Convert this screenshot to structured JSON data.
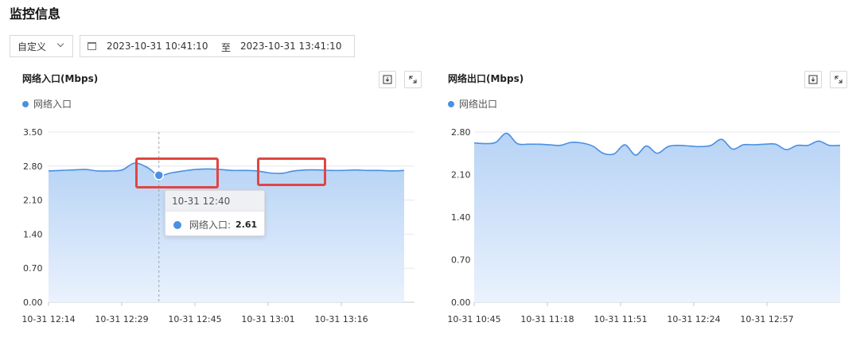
{
  "page": {
    "title": "监控信息"
  },
  "filter": {
    "range_select": "自定义",
    "start_time": "2023-10-31 10:41:10",
    "separator": "至",
    "end_time": "2023-10-31 13:41:10"
  },
  "panels": [
    {
      "title": "网络入口(Mbps)",
      "legend": "网络入口"
    },
    {
      "title": "网络出口(Mbps)",
      "legend": "网络出口"
    }
  ],
  "tooltip": {
    "time": "10-31 12:40",
    "series": "网络入口:",
    "value": "2.61"
  },
  "icons": {
    "download": "download-icon",
    "expand": "expand-icon",
    "calendar": "calendar-icon",
    "dropdown": "chevron-down-icon"
  },
  "colors": {
    "line": "#4a90e2",
    "area_top": "#b7d3f5",
    "area_bottom": "#eaf2fd",
    "highlight": "#e04545"
  },
  "chart_data": [
    {
      "type": "area",
      "title": "网络入口(Mbps)",
      "series": [
        {
          "name": "网络入口",
          "values": [
            2.7,
            2.71,
            2.72,
            2.73,
            2.7,
            2.7,
            2.72,
            2.86,
            2.78,
            2.61,
            2.66,
            2.7,
            2.73,
            2.74,
            2.73,
            2.71,
            2.71,
            2.7,
            2.66,
            2.65,
            2.7,
            2.72,
            2.72,
            2.71,
            2.71,
            2.72,
            2.71,
            2.71,
            2.7,
            2.71
          ]
        }
      ],
      "x_ticks": [
        "10-31 12:14",
        "10-31 12:29",
        "10-31 12:45",
        "10-31 13:01",
        "10-31 13:16"
      ],
      "y_ticks": [
        "3.50",
        "2.80",
        "2.10",
        "1.40",
        "0.70",
        "0.00"
      ],
      "ylim": [
        0,
        3.5
      ]
    },
    {
      "type": "area",
      "title": "网络出口(Mbps)",
      "series": [
        {
          "name": "网络出口",
          "values": [
            2.62,
            2.61,
            2.63,
            2.78,
            2.61,
            2.6,
            2.6,
            2.59,
            2.58,
            2.63,
            2.62,
            2.57,
            2.45,
            2.44,
            2.59,
            2.42,
            2.57,
            2.45,
            2.56,
            2.58,
            2.57,
            2.56,
            2.58,
            2.68,
            2.52,
            2.59,
            2.59,
            2.6,
            2.6,
            2.51,
            2.58,
            2.58,
            2.65,
            2.58,
            2.58
          ]
        }
      ],
      "x_ticks": [
        "10-31 10:45",
        "10-31 11:18",
        "10-31 11:51",
        "10-31 12:24",
        "10-31 12:57"
      ],
      "y_ticks": [
        "2.80",
        "2.10",
        "1.40",
        "0.70",
        "0.00"
      ],
      "ylim": [
        0,
        2.8
      ]
    }
  ]
}
